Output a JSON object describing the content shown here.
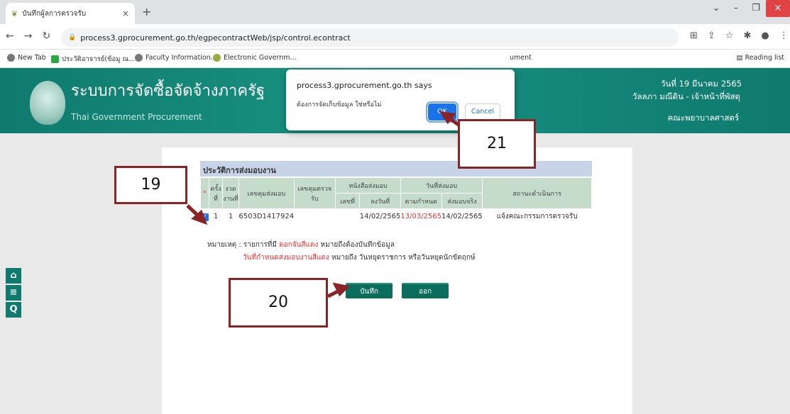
{
  "browser": {
    "tab_title": "บันทึกผู้ลการตรวจรับ",
    "tab_close": "×",
    "new_tab": "+",
    "url": "process3.gprocurement.go.th/egpecontractWeb/jsp/control.econtract",
    "bookmarks": [
      "New Tab",
      "ประวัติอาจารย์(ข้อมู ณ...",
      "Faculty Information...",
      "Electronic Governm...",
      "ument"
    ],
    "reading_list": "Reading list"
  },
  "site": {
    "title": "ระบบการจัดซื้อจัดจ้างภาครัฐ",
    "subtitle": "Thai Government Procurement",
    "date": "วันที่ 19 มีนาคม 2565",
    "user": "วัลลภา มณีดิน - เจ้าหน้าที่พัสดุ",
    "faculty": "คณะพยาบาลศาสตร์"
  },
  "section": {
    "title": "ประวัติการส่งมอบงาน"
  },
  "table": {
    "headers": {
      "req": "*",
      "round": "ครั้งที่",
      "period": "งวดงานที่",
      "deliver_no": "เลขคุมส่งมอบ",
      "inspect_no": "เลขคุมตรวจรับ",
      "doc_group": "หนังสือส่งมอบ",
      "doc_no": "เลขที่",
      "doc_date": "ลงวันที่",
      "date_group": "วันที่ส่งมอบ",
      "due": "ตามกำหนด",
      "actual": "ส่งมอบจริง",
      "status": "สถานะดำเนินการ"
    },
    "row": {
      "round": "1",
      "period": "1",
      "deliver_no": "6503D1417924",
      "inspect_no": "",
      "doc_no": "",
      "doc_date": "14/02/2565",
      "due": "13/03/2565",
      "actual": "14/02/2565",
      "status": "แจ้งคณะกรรมการตรวจรับ"
    }
  },
  "notes": {
    "prefix": "หมายเหตุ : รายการที่มี",
    "red1": "ดอกจันสีแดง",
    "rest1": "หมายถึงต้องบันทึกข้อมูล",
    "red2": "วันที่กำหนดส่งมอบงานสีแดง",
    "rest2": "หมายถึง วันหยุดราชการ หรือวันหยุดนักขัตฤกษ์"
  },
  "buttons": {
    "save": "บันทึก",
    "exit": "ออก"
  },
  "dialog": {
    "title": "process3.gprocurement.go.th says",
    "message": "ต้องการจัดเก็บข้อมูล ใช่หรือไม่",
    "ok": "OK",
    "cancel": "Cancel"
  },
  "annotations": {
    "a19": "19",
    "a20": "20",
    "a21": "21"
  },
  "colors": {
    "brand_teal": "#0f7a6e",
    "annotation_border": "#8b2525",
    "dialog_accent": "#1a73e8"
  }
}
